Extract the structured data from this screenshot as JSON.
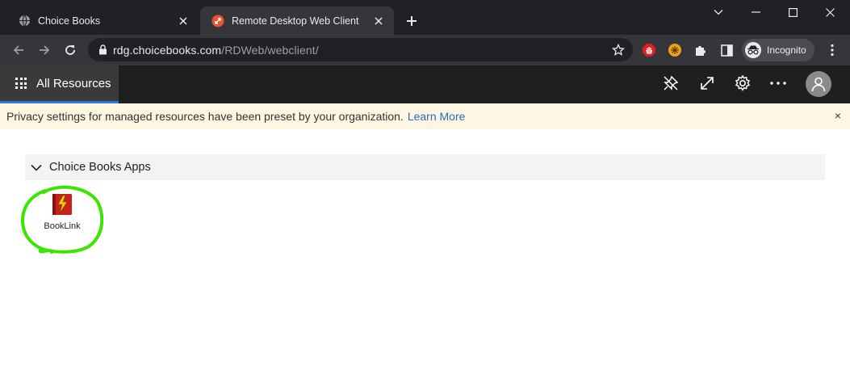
{
  "browser": {
    "tabs": [
      {
        "title": "Choice Books",
        "icon": "globe-icon"
      },
      {
        "title": "Remote Desktop Web Client",
        "icon": "remote-desktop-icon"
      }
    ],
    "address_host": "rdg.choicebooks.com",
    "address_path": "/RDWeb/webclient/",
    "profile_label": "Incognito"
  },
  "rd_header": {
    "all_resources_label": "All Resources"
  },
  "banner": {
    "message": "Privacy settings for managed resources have been preset by your organization.",
    "link": "Learn More",
    "close_glyph": "×"
  },
  "section": {
    "title": "Choice Books Apps",
    "apps": [
      {
        "label": "BookLink",
        "icon": "booklink-app-icon"
      }
    ]
  },
  "colors": {
    "accent": "#2a7ad8",
    "annotation": "#39e600",
    "banner_bg": "#fdf6e3",
    "link": "#2a6ebb"
  }
}
